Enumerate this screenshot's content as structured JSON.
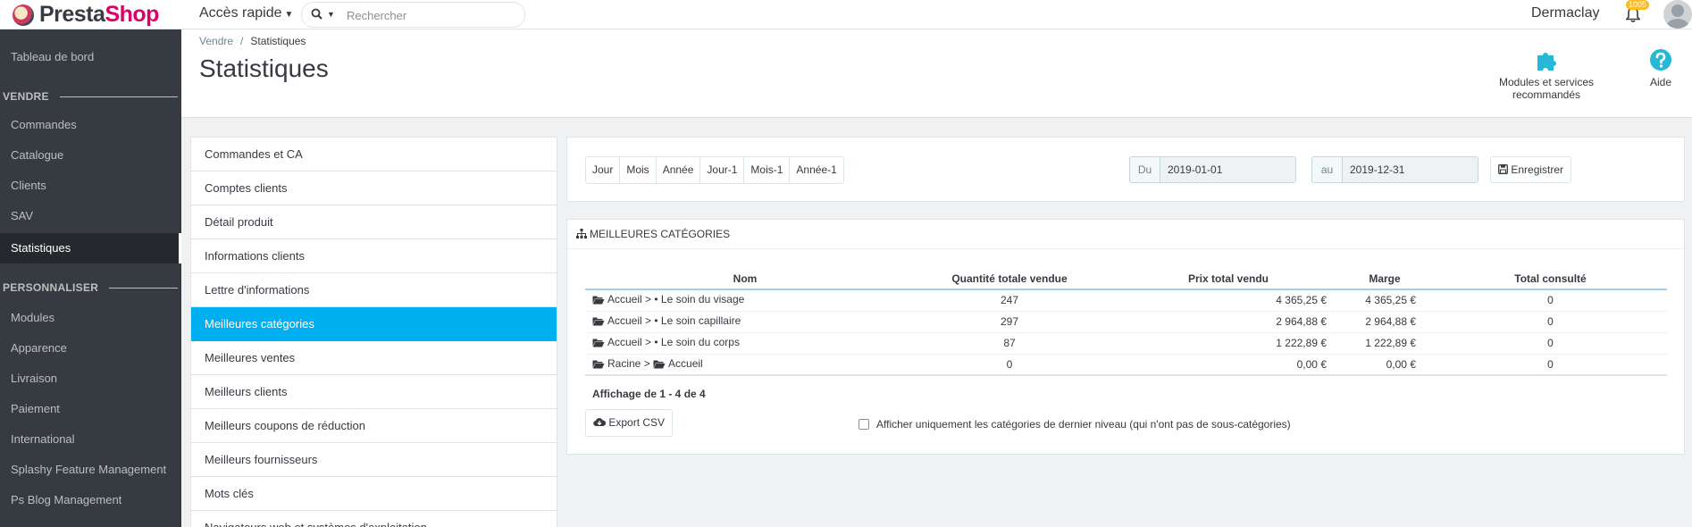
{
  "brand": {
    "part1": "Presta",
    "part2": "Shop"
  },
  "topbar": {
    "quick_access": "Accès rapide",
    "search_placeholder": "Rechercher",
    "shop_name": "Dermaclay",
    "notifications_count": "1005"
  },
  "sidebar": {
    "dashboard": "Tableau de bord",
    "section_sell": "VENDRE",
    "items_sell": [
      "Commandes",
      "Catalogue",
      "Clients",
      "SAV",
      "Statistiques"
    ],
    "section_customize": "PERSONNALISER",
    "items_customize": [
      "Modules",
      "Apparence",
      "Livraison",
      "Paiement",
      "International",
      "Splashy Feature Management",
      "Ps Blog Management"
    ]
  },
  "header": {
    "breadcrumb_parent": "Vendre",
    "breadcrumb_current": "Statistiques",
    "title": "Statistiques",
    "modules_label": "Modules et services recommandés",
    "help_label": "Aide"
  },
  "stats_menu": [
    "Commandes et CA",
    "Comptes clients",
    "Détail produit",
    "Informations clients",
    "Lettre d'informations",
    "Meilleures catégories",
    "Meilleures ventes",
    "Meilleurs clients",
    "Meilleurs coupons de réduction",
    "Meilleurs fournisseurs",
    "Mots clés",
    "Navigateurs web et systèmes d'exploitation"
  ],
  "date_filter": {
    "periods": [
      "Jour",
      "Mois",
      "Année",
      "Jour-1",
      "Mois-1",
      "Année-1"
    ],
    "from_label": "Du",
    "from_value": "2019-01-01",
    "to_label": "au",
    "to_value": "2019-12-31",
    "save_label": "Enregistrer"
  },
  "categories_panel": {
    "title": "MEILLEURES CATÉGORIES",
    "columns": [
      "Nom",
      "Quantité totale vendue",
      "Prix total vendu",
      "Marge",
      "Total consulté"
    ],
    "rows": [
      {
        "prefix": "Accueil > • Le soin du visage",
        "qty": "247",
        "price": "4 365,25 €",
        "margin": "4 365,25 €",
        "views": "0"
      },
      {
        "prefix": "Accueil > • Le soin capillaire",
        "qty": "297",
        "price": "2 964,88 €",
        "margin": "2 964,88 €",
        "views": "0"
      },
      {
        "prefix": "Accueil > • Le soin du corps",
        "qty": "87",
        "price": "1 222,89 €",
        "margin": "1 222,89 €",
        "views": "0"
      }
    ],
    "last_row": {
      "part1": "Racine > ",
      "part2": "Accueil",
      "qty": "0",
      "price": "0,00 €",
      "margin": "0,00 €",
      "views": "0"
    },
    "pagination": "Affichage de 1 - 4 de 4",
    "export_label": "Export CSV",
    "leaf_only_label": "Afficher uniquement les catégories de dernier niveau (qui n'ont pas de sous-catégories)"
  },
  "colors": {
    "accent": "#00aff0",
    "brand_pink": "#df0067",
    "sidebar_bg": "#363a41",
    "badge": "#fbbb22"
  }
}
